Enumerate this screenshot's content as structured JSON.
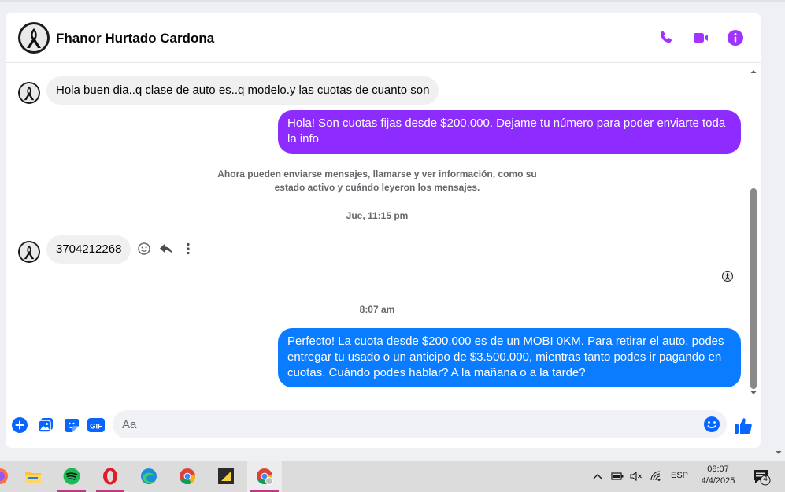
{
  "contact": {
    "name": "Fhanor Hurtado Cardona"
  },
  "header": {
    "icons": [
      "phone-icon",
      "video-call-icon",
      "info-icon"
    ],
    "accent_color": "#a033ff"
  },
  "messages": [
    {
      "direction": "in",
      "text": "Hola buen dia..q clase de auto es..q modelo.y las cuotas de cuanto son"
    },
    {
      "direction": "out",
      "text": "Hola! Son cuotas fijas desde $200.000. Dejame tu número para poder enviarte toda la info",
      "color": "#8e2cff"
    },
    {
      "type": "system",
      "text": "Ahora pueden enviarse mensajes, llamarse y ver información, como su estado activo y cuándo leyeron los mensajes."
    },
    {
      "type": "timestamp",
      "text": "Jue, 11:15 pm"
    },
    {
      "direction": "in",
      "text": "3704212268"
    },
    {
      "type": "timestamp",
      "text": "8:07 am"
    },
    {
      "direction": "out",
      "text": "Perfecto! La cuota desde $200.000 es de un MOBI 0KM. Para retirar el auto, podes entregar tu usado o un anticipo de $3.500.000, mientras tanto podes ir pagando en cuotas. Cuándo podes hablar? A la mañana o a la tarde?",
      "color": "#0a7cff"
    }
  ],
  "composer": {
    "placeholder": "Aa",
    "icons": [
      "add-icon",
      "gallery-icon",
      "sticker-icon",
      "gif-icon",
      "emoji-icon",
      "thumbs-up-icon"
    ],
    "gif_label": "GIF",
    "accent_color": "#0866ff"
  },
  "taskbar": {
    "apps": [
      "firefox",
      "file-explorer",
      "spotify",
      "opera",
      "edge",
      "chrome",
      "sticky-notes",
      "chrome-profile"
    ],
    "tray": {
      "language": "ESP",
      "notifications_count": "4"
    },
    "clock": {
      "time": "08:07",
      "date": "4/4/2025"
    }
  }
}
